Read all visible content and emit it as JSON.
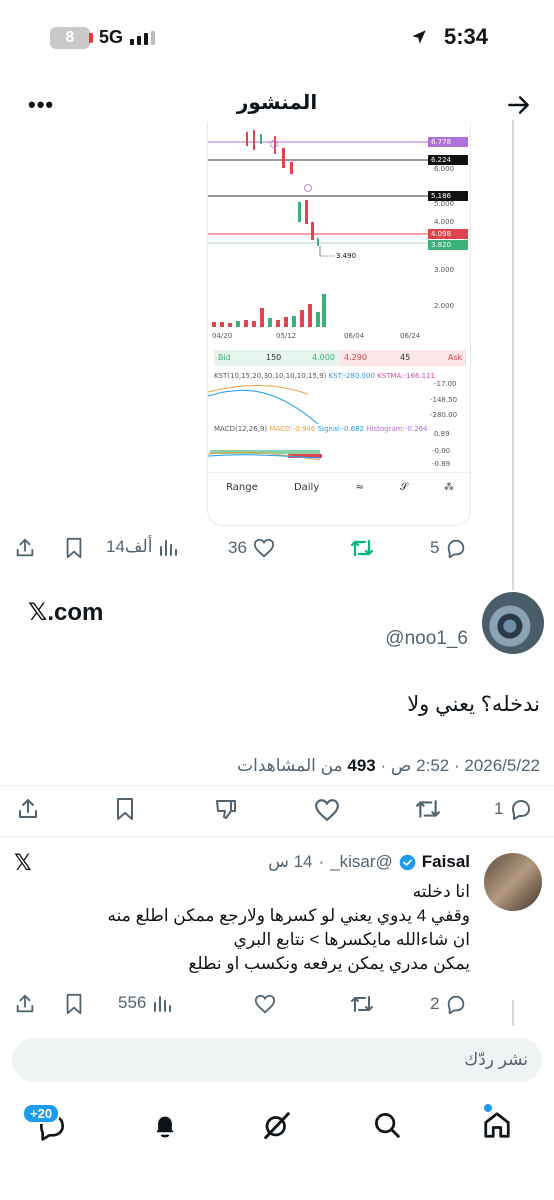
{
  "status_bar": {
    "time": "5:34",
    "battery": "8",
    "network": "5G"
  },
  "header": {
    "title": "المنشور",
    "more_icon": "more-horizontal-icon",
    "back_icon": "arrow-right-icon"
  },
  "chart_card": {
    "price_labels": [
      "6.778",
      "6.224",
      "5.186",
      "4.098",
      "3.820"
    ],
    "axis_labels": [
      "6.000",
      "5.000",
      "4.000",
      "3.000",
      "2.000"
    ],
    "low_marker": "3.490",
    "x_labels": [
      "04/20",
      "05/12",
      "06/04",
      "06/24"
    ],
    "bid": {
      "label": "Bid",
      "qty": "150",
      "price": "4.000"
    },
    "ask": {
      "label": "Ask",
      "qty": "45",
      "price": "4.290"
    },
    "kst": {
      "title": "KST(10,15,20,30,10,10,10,15,9)",
      "kst": "KST:-280.000",
      "kstma": "KSTMA:-166.111",
      "levels": [
        "-17.00",
        "-148.50",
        "-280.00"
      ]
    },
    "macd": {
      "title": "MACD(12,26,9)",
      "macd": "MACD:-0.946",
      "signal": "Signal:-0.682",
      "hist": "Histogram:-0.264",
      "levels": [
        "0.89",
        "-0.00",
        "-0.89"
      ]
    },
    "toolbar": {
      "range": "Range",
      "daily": "Daily"
    }
  },
  "first_actions": {
    "replies": "5",
    "likes": "36",
    "views": "14ألف"
  },
  "main_tweet": {
    "source": "𝕏.com",
    "handle": "@noo1_6",
    "text": "ندخله؟ يعني ولا",
    "date": "2026/5/22",
    "time": "2:52 ص",
    "views_count": "493",
    "views_label": "من المشاهدات",
    "replies": "1"
  },
  "reply": {
    "name": "Faisal",
    "handle": "@kisar_",
    "age": "14 س",
    "lines": [
      "انا دخلته",
      "وقفي 4 يدوي يعني لو كسرها ولارجع ممكن اطلع منه",
      "ان شاءالله مايكسرها > نتابع البري",
      "يمكن مدري يمكن يرفعه ونكسب او نطلع"
    ],
    "replies": "2",
    "views": "556"
  },
  "composer": {
    "placeholder": "نشر ردّك"
  },
  "tabbar": {
    "messages_badge": "+20"
  },
  "colors": {
    "accent": "#1d9bf0",
    "retweet_green": "#00ba7c",
    "muted": "#536471"
  }
}
